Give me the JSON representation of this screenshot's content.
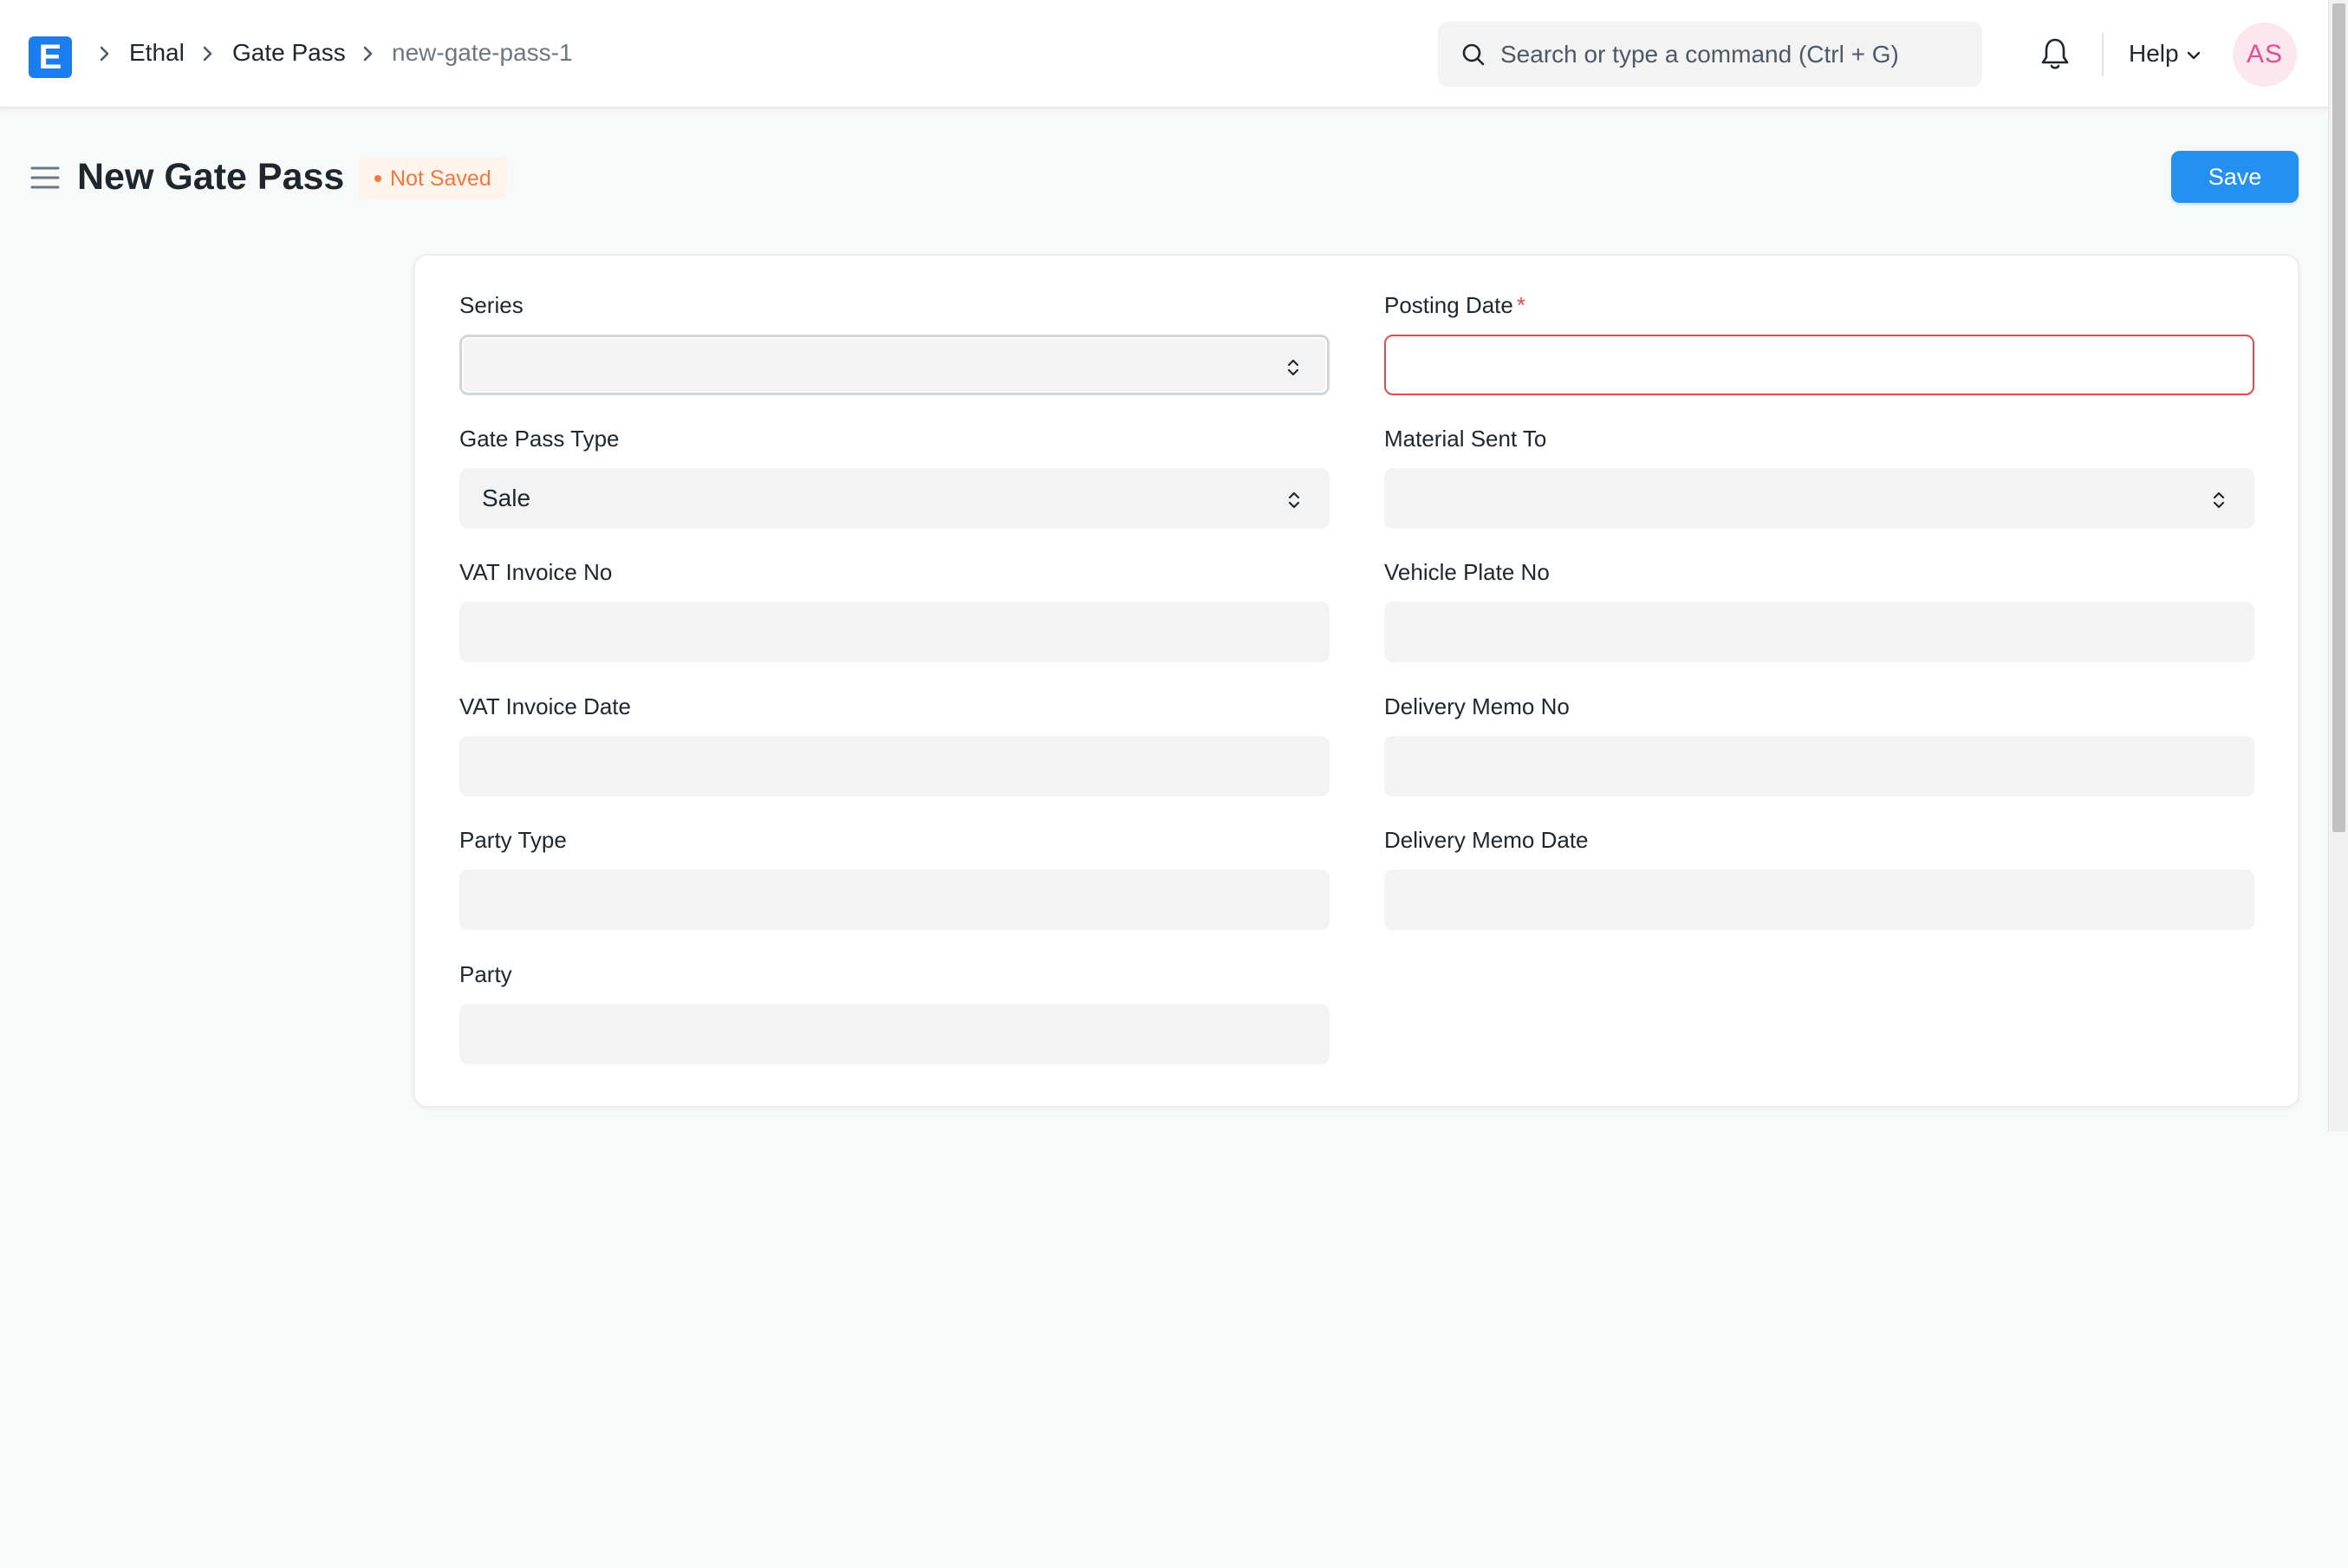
{
  "navbar": {
    "logo_letter": "E",
    "breadcrumbs": [
      "Ethal",
      "Gate Pass",
      "new-gate-pass-1"
    ],
    "search_placeholder": "Search or type a command (Ctrl + G)",
    "help_label": "Help",
    "avatar_initials": "AS"
  },
  "page": {
    "title": "New Gate Pass",
    "status": "Not Saved",
    "save_label": "Save"
  },
  "form": {
    "series": {
      "label": "Series",
      "value": ""
    },
    "posting_date": {
      "label": "Posting Date",
      "required_mark": "*",
      "value": ""
    },
    "gate_pass_type": {
      "label": "Gate Pass Type",
      "value": "Sale"
    },
    "material_sent_to": {
      "label": "Material Sent To",
      "value": ""
    },
    "vat_invoice_no": {
      "label": "VAT Invoice No",
      "value": ""
    },
    "vehicle_plate_no": {
      "label": "Vehicle Plate No",
      "value": ""
    },
    "vat_invoice_date": {
      "label": "VAT Invoice Date",
      "value": ""
    },
    "delivery_memo_no": {
      "label": "Delivery Memo No",
      "value": ""
    },
    "party_type": {
      "label": "Party Type",
      "value": ""
    },
    "delivery_memo_date": {
      "label": "Delivery Memo Date",
      "value": ""
    },
    "party": {
      "label": "Party",
      "value": ""
    }
  },
  "colors": {
    "primary": "#2490ef",
    "logo": "#1a7ef0",
    "status_orange": "#ee7a41",
    "required_red": "#e24c4c",
    "avatar_pink": "#e2508f"
  },
  "icons": [
    "app-logo",
    "chevron-right-icon",
    "search-icon",
    "bell-icon",
    "chevron-down-icon",
    "hamburger-menu-icon",
    "select-arrows-icon"
  ]
}
